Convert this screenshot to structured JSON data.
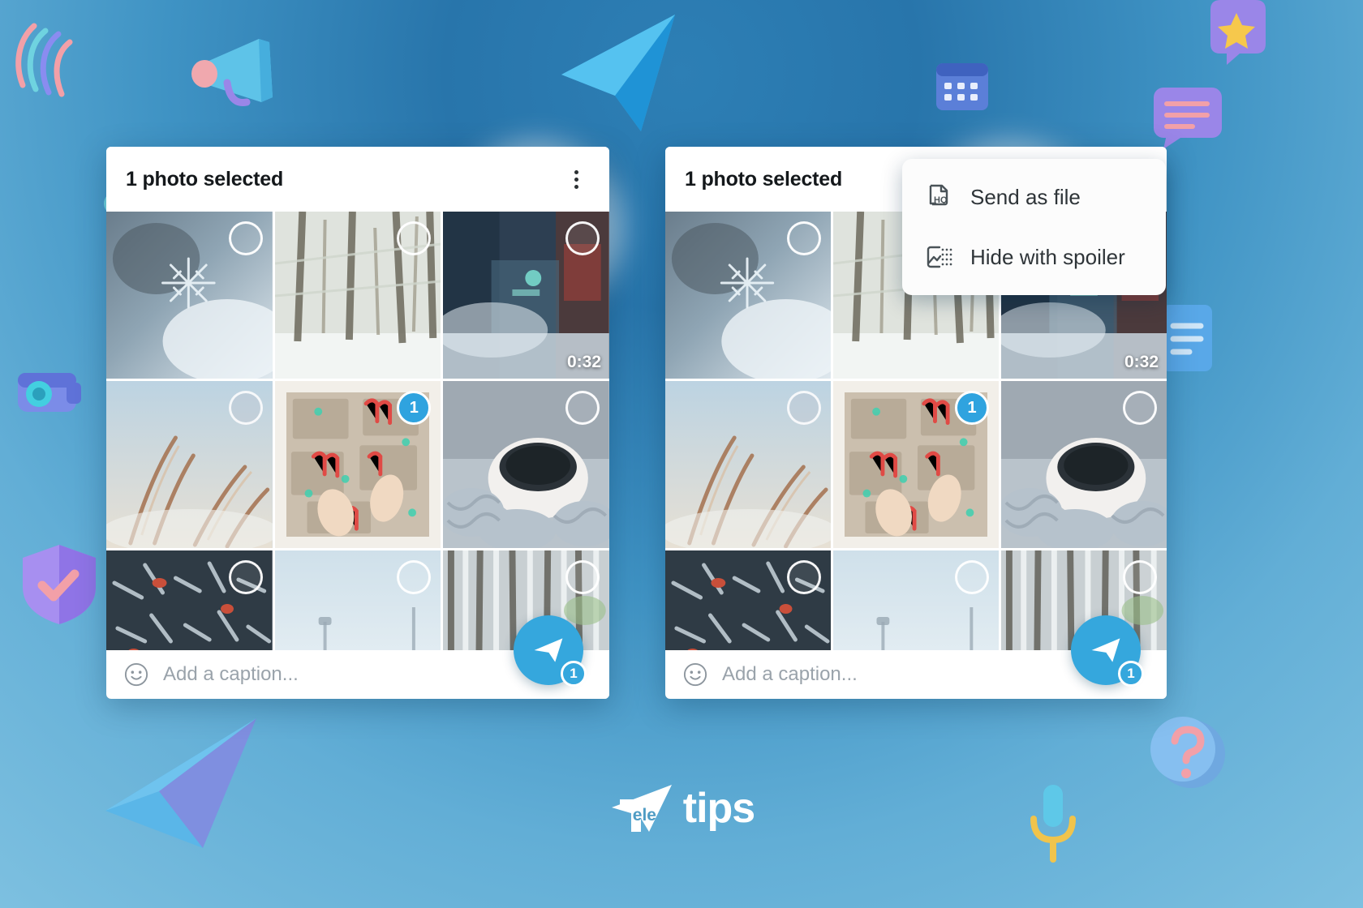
{
  "background": {
    "accent": "#35a7dd",
    "page_bg_top": "#2d7fb5",
    "page_bg_bottom": "#7dc0e0"
  },
  "brand": {
    "mark_inner_text": "ele",
    "word": "tips",
    "lead_letter": "T"
  },
  "panels": [
    {
      "id": "left",
      "header": {
        "title": "1 photo selected",
        "kebab_name": "more-options"
      },
      "caption": {
        "placeholder": "Add a caption...",
        "emoji_icon": "smiley-icon"
      },
      "send": {
        "icon": "send-icon",
        "badge": "1"
      },
      "grid": [
        {
          "name": "snowflake-macro",
          "selected": false,
          "bubble": "",
          "duration": ""
        },
        {
          "name": "snowy-forest",
          "selected": false,
          "bubble": "",
          "duration": ""
        },
        {
          "name": "snowy-street-video",
          "selected": false,
          "bubble": "",
          "duration": "0:32"
        },
        {
          "name": "frozen-grass",
          "selected": false,
          "bubble": "",
          "duration": ""
        },
        {
          "name": "candy-cane-gifts",
          "selected": true,
          "bubble": "1",
          "duration": ""
        },
        {
          "name": "coffee-cup-knit",
          "selected": false,
          "bubble": "",
          "duration": ""
        },
        {
          "name": "frosted-spruce",
          "selected": false,
          "bubble": "",
          "duration": ""
        },
        {
          "name": "foggy-street",
          "selected": false,
          "bubble": "",
          "duration": ""
        },
        {
          "name": "birch-forest",
          "selected": false,
          "bubble": "",
          "duration": ""
        }
      ]
    },
    {
      "id": "right",
      "header": {
        "title": "1 photo selected",
        "kebab_name": "more-options"
      },
      "caption": {
        "placeholder": "Add a caption...",
        "emoji_icon": "smiley-icon"
      },
      "send": {
        "icon": "send-icon",
        "badge": "1"
      },
      "grid": [
        {
          "name": "snowflake-macro",
          "selected": false,
          "bubble": "",
          "duration": ""
        },
        {
          "name": "snowy-forest",
          "selected": false,
          "bubble": "",
          "duration": ""
        },
        {
          "name": "snowy-street-video",
          "selected": false,
          "bubble": "",
          "duration": "0:32"
        },
        {
          "name": "frozen-grass",
          "selected": false,
          "bubble": "",
          "duration": ""
        },
        {
          "name": "candy-cane-gifts",
          "selected": true,
          "bubble": "1",
          "duration": ""
        },
        {
          "name": "coffee-cup-knit",
          "selected": false,
          "bubble": "",
          "duration": ""
        },
        {
          "name": "frosted-spruce",
          "selected": false,
          "bubble": "",
          "duration": ""
        },
        {
          "name": "foggy-street",
          "selected": false,
          "bubble": "",
          "duration": ""
        },
        {
          "name": "birch-forest",
          "selected": false,
          "bubble": "",
          "duration": ""
        }
      ]
    }
  ],
  "context_menu": {
    "items": [
      {
        "label": "Send as file",
        "icon": "file-hq-icon"
      },
      {
        "label": "Hide with spoiler",
        "icon": "image-spoiler-icon"
      }
    ]
  }
}
